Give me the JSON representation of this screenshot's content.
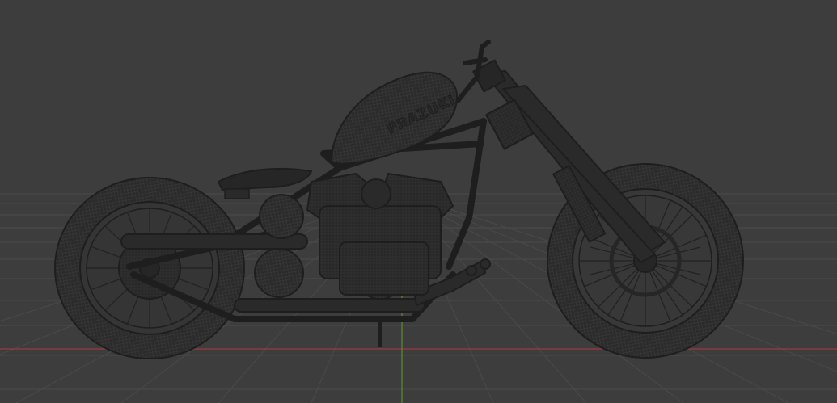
{
  "viewport": {
    "background": "#3d3d3d",
    "grid_color": "#4a4a4a",
    "axis_x_color": "#9c3a3a",
    "axis_y_color": "#5e8a2e",
    "wire_color": "#1e1e1e",
    "mesh_fill": "#2b2b2b"
  },
  "model": {
    "tank_logo": "PRAZUKI"
  }
}
